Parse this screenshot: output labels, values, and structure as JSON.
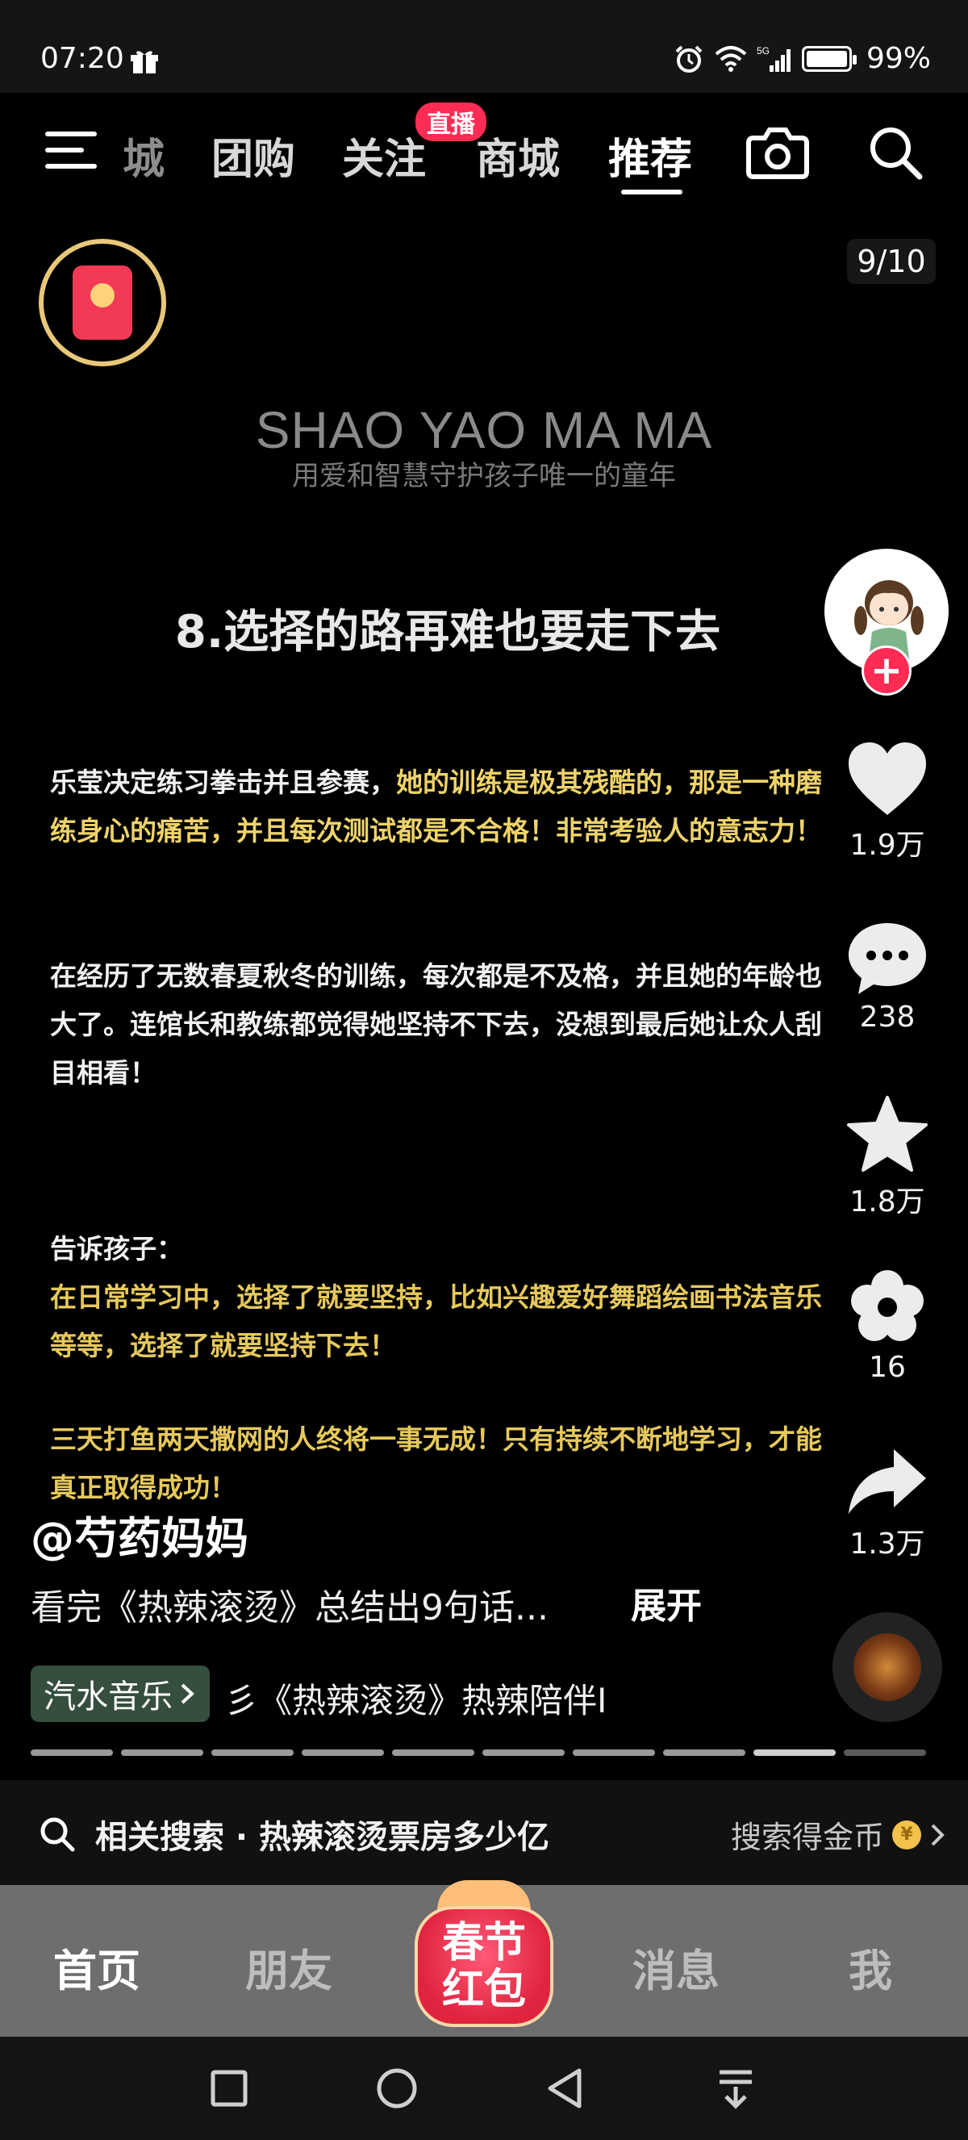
{
  "status_bar": {
    "time": "07:20",
    "network": "5G",
    "battery": "99%",
    "icons": [
      "gift-icon",
      "alarm-icon",
      "wifi-icon",
      "signal-icon",
      "battery-icon"
    ]
  },
  "top_nav": {
    "partial_tab": "城",
    "tabs": [
      {
        "label": "团购"
      },
      {
        "label": "关注"
      },
      {
        "label": "商城"
      },
      {
        "label": "推荐"
      }
    ],
    "active_tab": "推荐",
    "live_badge": "直播"
  },
  "video": {
    "page_counter": "9/10",
    "brand_en": "SHAO YAO MA MA",
    "brand_cn": "用爱和智慧守护孩子唯一的童年",
    "heading": "8.选择的路再难也要走下去",
    "paragraph1_white": "乐莹决定练习拳击并且参赛，",
    "paragraph1_yellow": "她的训练是极其残酷的，那是一种磨练身心的痛苦，并且每次测试都是不合格！非常考验人的意志力！",
    "paragraph2": "在经历了无数春夏秋冬的训练，每次都是不及格，并且她的年龄也大了。连馆长和教练都觉得她坚持不下去，没想到最后她让众人刮目相看！",
    "tell_kids_title": "告诉孩子：",
    "tell_kids_body": "在日常学习中，选择了就要坚持，比如兴趣爱好舞蹈绘画书法音乐等等，选择了就要坚持下去！",
    "closing": "三天打鱼两天撒网的人终将一事无成！只有持续不断地学习，才能真正取得成功！"
  },
  "rail": {
    "likes": "1.9万",
    "comments": "238",
    "favorites": "1.8万",
    "flower": "16",
    "shares": "1.3万"
  },
  "caption": {
    "author": "@芍药妈妈",
    "text": "看完《热辣滚烫》总结出9句话...",
    "expand": "展开",
    "music_tag": "汽水音乐",
    "music_marquee": "彡《热辣滚烫》热辣陪伴I"
  },
  "progress": {
    "segments": 10,
    "current": 9
  },
  "related_search": {
    "text": "相关搜索 · 热辣滚烫票房多少亿",
    "right_text": "搜索得金币",
    "coin_symbol": "¥"
  },
  "bottom_tabs": {
    "home": "首页",
    "friends": "朋友",
    "center_line1": "春节",
    "center_line2": "红包",
    "messages": "消息",
    "me": "我"
  },
  "colors": {
    "accent_red": "#fe2c55",
    "highlight_yellow": "#eed36a"
  }
}
